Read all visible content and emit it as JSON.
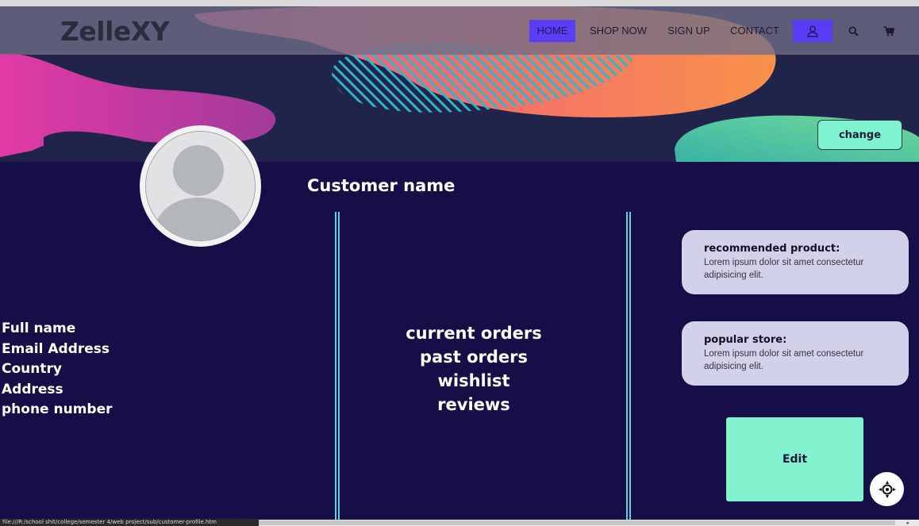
{
  "app": {
    "logo": "ZelleXY",
    "colors": {
      "banner_bg": "#20234a",
      "main_bg": "#150e47",
      "accent_purple": "#5b3df5",
      "accent_mint": "#82f3ce",
      "divider": "#5fd0d8",
      "card_bg": "#d2d1ea"
    }
  },
  "nav": {
    "items": [
      {
        "label": "HOME",
        "active": true
      },
      {
        "label": "SHOP NOW",
        "active": false
      },
      {
        "label": "SIGN UP",
        "active": false
      },
      {
        "label": "CONTACT",
        "active": false
      }
    ],
    "icons": [
      "user-icon",
      "search-icon",
      "cart-icon"
    ]
  },
  "banner": {
    "change_label": "change"
  },
  "profile": {
    "customer_name": "Customer name",
    "info_fields": [
      "Full name",
      "Email Address",
      "Country",
      "Address",
      "phone number"
    ],
    "orders_links": [
      "current orders",
      "past orders",
      "wishlist",
      "reviews"
    ]
  },
  "cards": [
    {
      "title": "recommended product:",
      "text": "Lorem ipsum dolor sit amet consectetur adipisicing elit."
    },
    {
      "title": "popular store:",
      "text": "Lorem ipsum dolor sit amet consectetur adipisicing elit."
    }
  ],
  "edit_label": "Edit",
  "status_bar": {
    "url": "file:///R:/school shit/college/semester 4/web project/sub/customer-profile.htm"
  }
}
